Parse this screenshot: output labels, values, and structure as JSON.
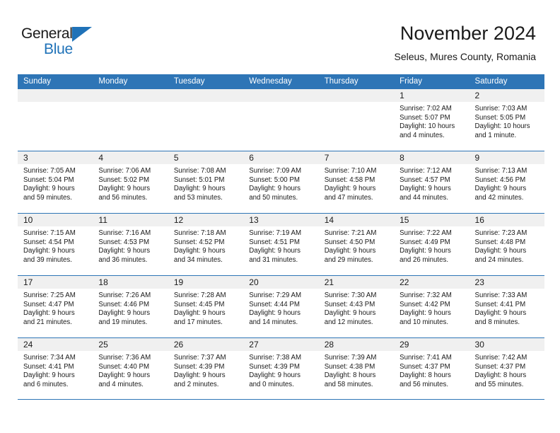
{
  "brand": {
    "name_top": "General",
    "name_bottom": "Blue",
    "accent_color": "#1f72b8"
  },
  "header": {
    "month_title": "November 2024",
    "location": "Seleus, Mures County, Romania"
  },
  "calendar": {
    "header_bg": "#2e75b6",
    "day_band_bg": "#f0f0f0",
    "weekdays": [
      "Sunday",
      "Monday",
      "Tuesday",
      "Wednesday",
      "Thursday",
      "Friday",
      "Saturday"
    ],
    "weeks": [
      [
        {
          "day": "",
          "lines": []
        },
        {
          "day": "",
          "lines": []
        },
        {
          "day": "",
          "lines": []
        },
        {
          "day": "",
          "lines": []
        },
        {
          "day": "",
          "lines": []
        },
        {
          "day": "1",
          "lines": [
            "Sunrise: 7:02 AM",
            "Sunset: 5:07 PM",
            "Daylight: 10 hours",
            "and 4 minutes."
          ]
        },
        {
          "day": "2",
          "lines": [
            "Sunrise: 7:03 AM",
            "Sunset: 5:05 PM",
            "Daylight: 10 hours",
            "and 1 minute."
          ]
        }
      ],
      [
        {
          "day": "3",
          "lines": [
            "Sunrise: 7:05 AM",
            "Sunset: 5:04 PM",
            "Daylight: 9 hours",
            "and 59 minutes."
          ]
        },
        {
          "day": "4",
          "lines": [
            "Sunrise: 7:06 AM",
            "Sunset: 5:02 PM",
            "Daylight: 9 hours",
            "and 56 minutes."
          ]
        },
        {
          "day": "5",
          "lines": [
            "Sunrise: 7:08 AM",
            "Sunset: 5:01 PM",
            "Daylight: 9 hours",
            "and 53 minutes."
          ]
        },
        {
          "day": "6",
          "lines": [
            "Sunrise: 7:09 AM",
            "Sunset: 5:00 PM",
            "Daylight: 9 hours",
            "and 50 minutes."
          ]
        },
        {
          "day": "7",
          "lines": [
            "Sunrise: 7:10 AM",
            "Sunset: 4:58 PM",
            "Daylight: 9 hours",
            "and 47 minutes."
          ]
        },
        {
          "day": "8",
          "lines": [
            "Sunrise: 7:12 AM",
            "Sunset: 4:57 PM",
            "Daylight: 9 hours",
            "and 44 minutes."
          ]
        },
        {
          "day": "9",
          "lines": [
            "Sunrise: 7:13 AM",
            "Sunset: 4:56 PM",
            "Daylight: 9 hours",
            "and 42 minutes."
          ]
        }
      ],
      [
        {
          "day": "10",
          "lines": [
            "Sunrise: 7:15 AM",
            "Sunset: 4:54 PM",
            "Daylight: 9 hours",
            "and 39 minutes."
          ]
        },
        {
          "day": "11",
          "lines": [
            "Sunrise: 7:16 AM",
            "Sunset: 4:53 PM",
            "Daylight: 9 hours",
            "and 36 minutes."
          ]
        },
        {
          "day": "12",
          "lines": [
            "Sunrise: 7:18 AM",
            "Sunset: 4:52 PM",
            "Daylight: 9 hours",
            "and 34 minutes."
          ]
        },
        {
          "day": "13",
          "lines": [
            "Sunrise: 7:19 AM",
            "Sunset: 4:51 PM",
            "Daylight: 9 hours",
            "and 31 minutes."
          ]
        },
        {
          "day": "14",
          "lines": [
            "Sunrise: 7:21 AM",
            "Sunset: 4:50 PM",
            "Daylight: 9 hours",
            "and 29 minutes."
          ]
        },
        {
          "day": "15",
          "lines": [
            "Sunrise: 7:22 AM",
            "Sunset: 4:49 PM",
            "Daylight: 9 hours",
            "and 26 minutes."
          ]
        },
        {
          "day": "16",
          "lines": [
            "Sunrise: 7:23 AM",
            "Sunset: 4:48 PM",
            "Daylight: 9 hours",
            "and 24 minutes."
          ]
        }
      ],
      [
        {
          "day": "17",
          "lines": [
            "Sunrise: 7:25 AM",
            "Sunset: 4:47 PM",
            "Daylight: 9 hours",
            "and 21 minutes."
          ]
        },
        {
          "day": "18",
          "lines": [
            "Sunrise: 7:26 AM",
            "Sunset: 4:46 PM",
            "Daylight: 9 hours",
            "and 19 minutes."
          ]
        },
        {
          "day": "19",
          "lines": [
            "Sunrise: 7:28 AM",
            "Sunset: 4:45 PM",
            "Daylight: 9 hours",
            "and 17 minutes."
          ]
        },
        {
          "day": "20",
          "lines": [
            "Sunrise: 7:29 AM",
            "Sunset: 4:44 PM",
            "Daylight: 9 hours",
            "and 14 minutes."
          ]
        },
        {
          "day": "21",
          "lines": [
            "Sunrise: 7:30 AM",
            "Sunset: 4:43 PM",
            "Daylight: 9 hours",
            "and 12 minutes."
          ]
        },
        {
          "day": "22",
          "lines": [
            "Sunrise: 7:32 AM",
            "Sunset: 4:42 PM",
            "Daylight: 9 hours",
            "and 10 minutes."
          ]
        },
        {
          "day": "23",
          "lines": [
            "Sunrise: 7:33 AM",
            "Sunset: 4:41 PM",
            "Daylight: 9 hours",
            "and 8 minutes."
          ]
        }
      ],
      [
        {
          "day": "24",
          "lines": [
            "Sunrise: 7:34 AM",
            "Sunset: 4:41 PM",
            "Daylight: 9 hours",
            "and 6 minutes."
          ]
        },
        {
          "day": "25",
          "lines": [
            "Sunrise: 7:36 AM",
            "Sunset: 4:40 PM",
            "Daylight: 9 hours",
            "and 4 minutes."
          ]
        },
        {
          "day": "26",
          "lines": [
            "Sunrise: 7:37 AM",
            "Sunset: 4:39 PM",
            "Daylight: 9 hours",
            "and 2 minutes."
          ]
        },
        {
          "day": "27",
          "lines": [
            "Sunrise: 7:38 AM",
            "Sunset: 4:39 PM",
            "Daylight: 9 hours",
            "and 0 minutes."
          ]
        },
        {
          "day": "28",
          "lines": [
            "Sunrise: 7:39 AM",
            "Sunset: 4:38 PM",
            "Daylight: 8 hours",
            "and 58 minutes."
          ]
        },
        {
          "day": "29",
          "lines": [
            "Sunrise: 7:41 AM",
            "Sunset: 4:37 PM",
            "Daylight: 8 hours",
            "and 56 minutes."
          ]
        },
        {
          "day": "30",
          "lines": [
            "Sunrise: 7:42 AM",
            "Sunset: 4:37 PM",
            "Daylight: 8 hours",
            "and 55 minutes."
          ]
        }
      ]
    ]
  }
}
